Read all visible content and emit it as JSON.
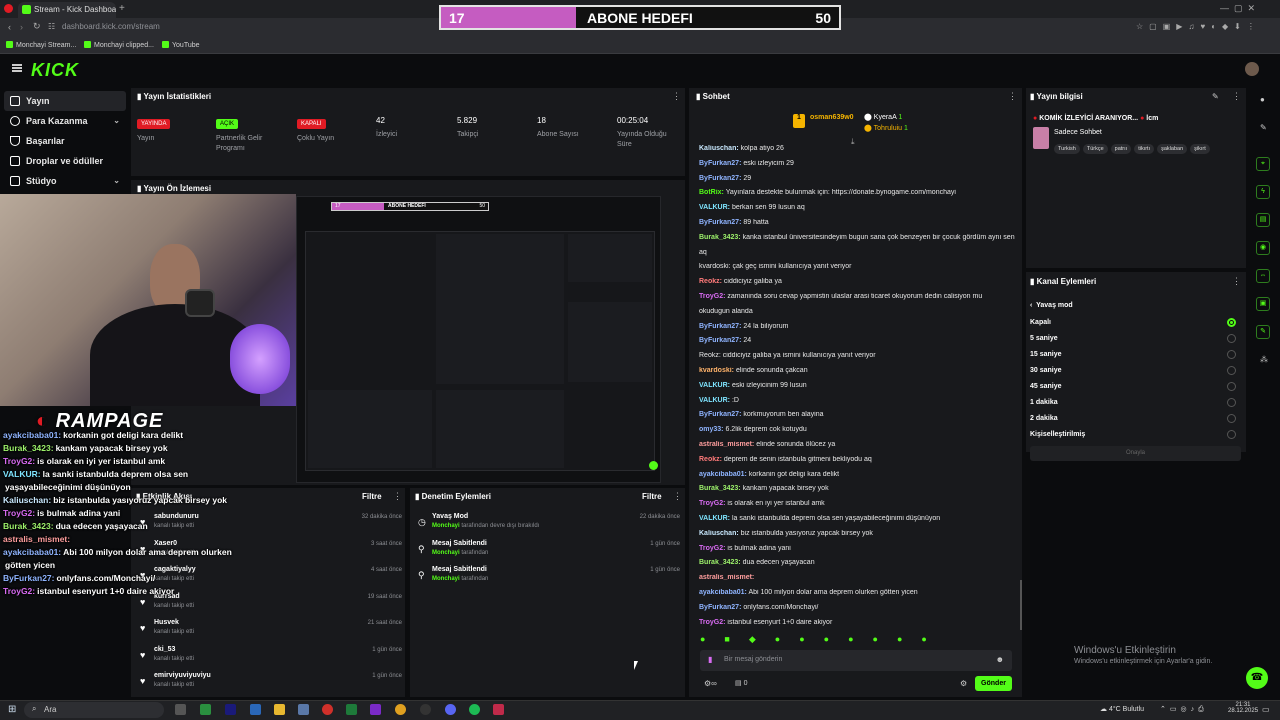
{
  "browser": {
    "tab_title": "Stream - Kick Dashboard",
    "url": "dashboard.kick.com/stream",
    "bookmarks": [
      "Monchayi Stream...",
      "Monchayi clipped...",
      "YouTube"
    ]
  },
  "goal_overlay": {
    "current": "17",
    "title": "ABONE HEDEFI",
    "target": "50",
    "progress": 0.34,
    "fill_color": "#c55cc1"
  },
  "header": {
    "logo": "KICK"
  },
  "sidebar": {
    "items": [
      {
        "label": "Yayın",
        "icon": "video-icon",
        "expandable": false
      },
      {
        "label": "Para Kazanma",
        "icon": "money-icon",
        "expandable": true
      },
      {
        "label": "Başarılar",
        "icon": "trophy-icon",
        "expandable": false
      },
      {
        "label": "Droplar ve ödüller",
        "icon": "gift-icon",
        "expandable": false
      },
      {
        "label": "Stüdyo",
        "icon": "studio-icon",
        "expandable": true
      }
    ]
  },
  "stats": {
    "title": "Yayın İstatistikleri",
    "items": [
      {
        "value": "YAYINDA",
        "label": "Yayın",
        "kind": "red"
      },
      {
        "value": "AÇIK",
        "label": "Partnerlik Gelir Programı",
        "kind": "green"
      },
      {
        "value": "KAPALI",
        "label": "Çoklu Yayın",
        "kind": "red"
      },
      {
        "value": "42",
        "label": "İzleyici",
        "kind": "num"
      },
      {
        "value": "5.829",
        "label": "Takipçi",
        "kind": "num"
      },
      {
        "value": "18",
        "label": "Abone Sayısı",
        "kind": "num"
      },
      {
        "value": "00:25:04",
        "label": "Yayında Olduğu Süre",
        "kind": "num"
      }
    ]
  },
  "preview": {
    "title": "Yayın Ön İzlemesi",
    "brand": "RAMPAGE",
    "mini_goal_current": "17",
    "mini_goal_title": "ABONE HEDEFI",
    "mini_goal_target": "50"
  },
  "overlay_chat": [
    {
      "user": "ayakcibaba01:",
      "text": "korkanin got deligi kara delikt",
      "color": "#8fb4ff"
    },
    {
      "user": "Burak_3423:",
      "text": "kankam yapacak birsey yok",
      "color": "#9df26b"
    },
    {
      "user": "TroyG2:",
      "text": "is olarak en iyi yer istanbul amk",
      "color": "#d86bf2"
    },
    {
      "user": "VALKUR:",
      "text": "la sanki istanbulda deprem olsa sen",
      "color": "#7fe4ff"
    },
    {
      "user": "",
      "text": "yaşayabileceğinimi düşünüyon",
      "color": "#ffffff"
    },
    {
      "user": "Kaliuschan:",
      "text": "biz istanbulda yasıyoruz yapcak birsey yok",
      "color": "#c9e9ff"
    },
    {
      "user": "TroyG2:",
      "text": "is bulmak adina yani",
      "color": "#d86bf2"
    },
    {
      "user": "Burak_3423:",
      "text": "dua edecen yaşayacan",
      "color": "#9df26b"
    },
    {
      "user": "astralis_mismet:",
      "text": "",
      "color": "#ff9e9e"
    },
    {
      "user": "ayakcibaba01:",
      "text": "Abi 100 milyon dolar ama deprem olurken",
      "color": "#8fb4ff"
    },
    {
      "user": "",
      "text": "götten yicen",
      "color": "#ffffff"
    },
    {
      "user": "ByFurkan27:",
      "text": "onlyfans.com/Monchayi/",
      "color": "#8fb4ff"
    },
    {
      "user": "TroyG2:",
      "text": "istanbul esenyurt 1+0 daire akiyor",
      "color": "#d86bf2"
    }
  ],
  "activity": {
    "title": "Etkinlik Akışı",
    "filter": "Filtre",
    "items": [
      {
        "name": "sabundunuru",
        "sub": "kanalı takip etti",
        "time": "32 dakika önce"
      },
      {
        "name": "Xaser0",
        "sub": "kanalı takip etti",
        "time": "3 saat önce"
      },
      {
        "name": "cagaktiyalyy",
        "sub": "kanalı takip etti",
        "time": "4 saat önce"
      },
      {
        "name": "kurrsad",
        "sub": "kanalı takip etti",
        "time": "19 saat önce"
      },
      {
        "name": "Husvek",
        "sub": "kanalı takip etti",
        "time": "21 saat önce"
      },
      {
        "name": "cki_53",
        "sub": "kanalı takip etti",
        "time": "1 gün önce"
      },
      {
        "name": "emirviyuviyuviyu",
        "sub": "kanalı takip etti",
        "time": "1 gün önce"
      }
    ]
  },
  "moderation": {
    "title": "Denetim Eylemleri",
    "filter": "Filtre",
    "items": [
      {
        "name": "Yavaş Mod",
        "actor": "Monchayi",
        "sub": "tarafından devre dışı bırakıldı",
        "time": "22 dakika önce"
      },
      {
        "name": "Mesaj Sabitlendi",
        "actor": "Monchayi",
        "sub": "tarafından",
        "time": "1 gün önce"
      },
      {
        "name": "Mesaj Sabitlendi",
        "actor": "Monchayi",
        "sub": "tarafından",
        "time": "1 gün önce"
      }
    ]
  },
  "chat": {
    "title": "Sohbet",
    "top_gifters": [
      {
        "name": "osman639w0",
        "count": ""
      },
      {
        "name": "KyeraA",
        "count": "1"
      },
      {
        "name": "Tohruluiu",
        "count": "1"
      }
    ],
    "messages": [
      {
        "user": "Kaliuschan:",
        "text": "kolpa atiyo 26",
        "color": "#c9e9ff"
      },
      {
        "user": "ByFurkan27:",
        "text": "eski izleyicim 29",
        "color": "#8fb4ff"
      },
      {
        "user": "ByFurkan27:",
        "text": "29",
        "color": "#8fb4ff"
      },
      {
        "user": "BotRix:",
        "text": "Yayınlara destekte bulunmak için: https://donate.bynogame.com/monchayi",
        "color": "#53fc18"
      },
      {
        "user": "VALKUR:",
        "text": "berkan sen 99 lusun aq",
        "color": "#7fe4ff"
      },
      {
        "user": "ByFurkan27:",
        "text": "89 hatta",
        "color": "#8fb4ff"
      },
      {
        "user": "Burak_3423:",
        "text": "kanka istanbul üniversitesindeyim bugun sana çok benzeyen bir çocuk gördüm aynı sen",
        "color": "#9df26b"
      },
      {
        "user": "",
        "text": "aq",
        "color": "#ffffff"
      },
      {
        "user": "",
        "text": "kvardoski: çak geç ismini kullanıcıya yanıt veriyor",
        "color": "#7d7f84"
      },
      {
        "user": "Reokz:",
        "text": "ciddiciyiz galiba ya",
        "color": "#ff7a7a"
      },
      {
        "user": "TroyG2:",
        "text": "zamaninda soru cevap yapmistin ulaslar arasi ticaret okuyorum dedin calisiyon mu",
        "color": "#d86bf2"
      },
      {
        "user": "",
        "text": "okudugun alanda",
        "color": "#ffffff"
      },
      {
        "user": "ByFurkan27:",
        "text": "24 la biliyorum",
        "color": "#8fb4ff"
      },
      {
        "user": "ByFurkan27:",
        "text": "24",
        "color": "#8fb4ff"
      },
      {
        "user": "",
        "text": "Reokz: ciddiciyiz galiba ya ismini kullanıcıya yanıt veriyor",
        "color": "#7d7f84"
      },
      {
        "user": "kvardoski:",
        "text": "elinde sonunda çakcan",
        "color": "#ffb36b"
      },
      {
        "user": "VALKUR:",
        "text": "eski izleyicinim 99 lusun",
        "color": "#7fe4ff"
      },
      {
        "user": "VALKUR:",
        "text": ":D",
        "color": "#7fe4ff"
      },
      {
        "user": "ByFurkan27:",
        "text": "korkmuyorum ben alayina",
        "color": "#8fb4ff"
      },
      {
        "user": "omy33:",
        "text": "6.2lik deprem cok kotuydu",
        "color": "#8fb4ff"
      },
      {
        "user": "astralis_mismet:",
        "text": "elinde sonunda ölücez ya",
        "color": "#ff9e9e"
      },
      {
        "user": "Reokz:",
        "text": "deprem de senin istanbula gitmeni bekliyodu aq",
        "color": "#ff7a7a"
      },
      {
        "user": "ayakcibaba01:",
        "text": "korkanin got deligi kara delikt",
        "color": "#8fb4ff"
      },
      {
        "user": "Burak_3423:",
        "text": "kankam yapacak birsey yok",
        "color": "#9df26b"
      },
      {
        "user": "TroyG2:",
        "text": "is olarak en iyi yer istanbul amk",
        "color": "#d86bf2"
      },
      {
        "user": "VALKUR:",
        "text": "la sanki istanbulda deprem olsa sen yaşayabileceğinimi düşünüyon",
        "color": "#7fe4ff"
      },
      {
        "user": "Kaliuschan:",
        "text": "biz istanbulda yasıyoruz yapcak birsey yok",
        "color": "#c9e9ff"
      },
      {
        "user": "TroyG2:",
        "text": "is bulmak adina yani",
        "color": "#d86bf2"
      },
      {
        "user": "Burak_3423:",
        "text": "dua edecen yaşayacan",
        "color": "#9df26b"
      },
      {
        "user": "astralis_mismet:",
        "text": "",
        "color": "#ff9e9e"
      },
      {
        "user": "ayakcibaba01:",
        "text": "Abi 100 milyon dolar ama deprem olurken götten yicen",
        "color": "#8fb4ff"
      },
      {
        "user": "ByFurkan27:",
        "text": "onlyfans.com/Monchayi/",
        "color": "#8fb4ff"
      },
      {
        "user": "TroyG2:",
        "text": "istanbul esenyurt 1+0 daire akiyor",
        "color": "#d86bf2"
      }
    ],
    "input_placeholder": "Bir mesaj gönderin",
    "send_label": "Gönder",
    "count_value": "0"
  },
  "stream_info": {
    "title": "Yayın bilgisi",
    "stream_title": "KOMİK İZLEYİCİ ARANIYOR...",
    "lcm": "lcm",
    "category": "Sadece Sohbet",
    "tags": [
      "Turkish",
      "Türkçe",
      "patrıı",
      "tikırtı",
      "şaklaban",
      "şikırt"
    ]
  },
  "channel_actions": {
    "title": "Kanal Eylemleri",
    "back_label": "Yavaş mod",
    "options": [
      {
        "label": "Kapalı",
        "selected": true
      },
      {
        "label": "5 saniye",
        "selected": false
      },
      {
        "label": "15 saniye",
        "selected": false
      },
      {
        "label": "30 saniye",
        "selected": false
      },
      {
        "label": "45 saniye",
        "selected": false
      },
      {
        "label": "1 dakika",
        "selected": false
      },
      {
        "label": "2 dakika",
        "selected": false
      },
      {
        "label": "Kişiselleştirilmiş",
        "selected": false
      }
    ],
    "confirm_label": "Onayla"
  },
  "watermark": {
    "line1": "Windows'u Etkinleştirin",
    "line2": "Windows'u etkinleştirmek için Ayarlar'a gidin."
  },
  "taskbar": {
    "search_placeholder": "Ara",
    "weather": "4°C Bulutlu",
    "time": "21:31",
    "date": "28.12.2025"
  },
  "colors": {
    "accent": "#53fc18",
    "live_red": "#e01b24",
    "panel": "#18191c",
    "bg": "#0b0c0e"
  }
}
